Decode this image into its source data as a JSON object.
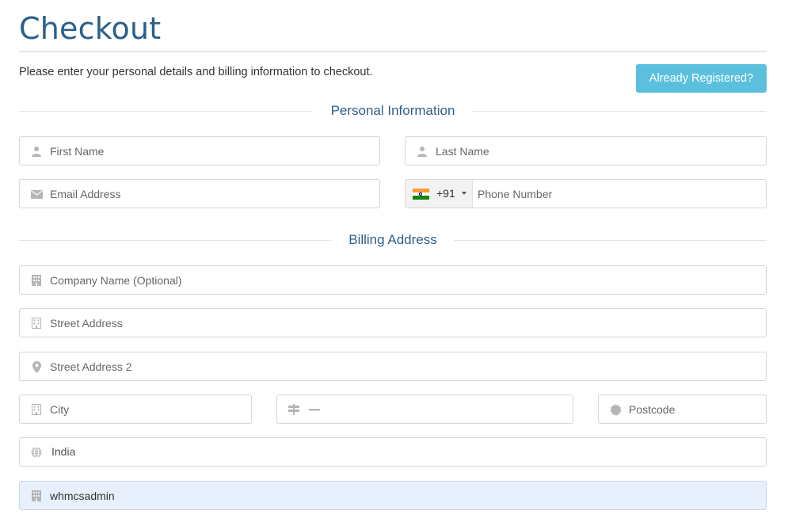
{
  "page": {
    "title": "Checkout",
    "intro": "Please enter your personal details and billing information to checkout.",
    "already_registered_label": "Already Registered?"
  },
  "personal": {
    "heading": "Personal Information",
    "first_name": {
      "placeholder": "First Name",
      "icon": "user-icon"
    },
    "last_name": {
      "placeholder": "Last Name",
      "icon": "user-icon"
    },
    "email": {
      "placeholder": "Email Address",
      "icon": "envelope-icon"
    },
    "phone": {
      "country_flag": "india-flag-icon",
      "dial_code": "+91",
      "placeholder": "Phone Number"
    }
  },
  "billing": {
    "heading": "Billing Address",
    "company": {
      "placeholder": "Company Name (Optional)",
      "icon": "building-icon"
    },
    "street": {
      "placeholder": "Street Address",
      "icon": "building-icon"
    },
    "street2": {
      "placeholder": "Street Address 2",
      "icon": "map-marker-icon"
    },
    "city": {
      "placeholder": "City",
      "icon": "building-icon"
    },
    "state": {
      "value": "—",
      "icon": "signpost-icon"
    },
    "postcode": {
      "placeholder": "Postcode",
      "icon": "certificate-icon"
    },
    "country": {
      "value": "India",
      "icon": "globe-icon"
    },
    "tax": {
      "value": "whmcsadmin",
      "icon": "building-icon"
    }
  },
  "colors": {
    "accent": "#2b5f8a",
    "button": "#5bc0de",
    "autofill": "#e8f0fe",
    "border": "#d6d6d6"
  }
}
